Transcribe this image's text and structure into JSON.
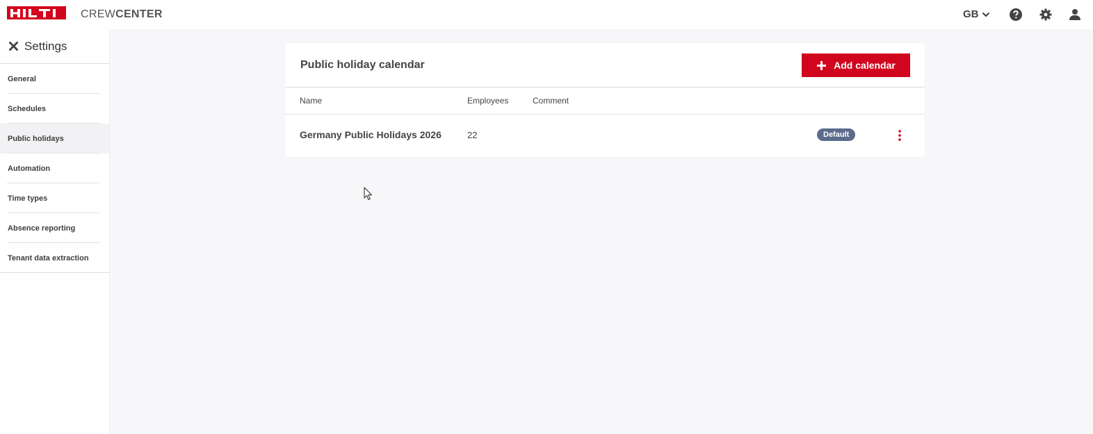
{
  "header": {
    "brand": "HILTI",
    "app_name_light": "CREW",
    "app_name_bold": "CENTER",
    "region": "GB",
    "icons": [
      "chevron-down-icon",
      "help-icon",
      "gear-icon",
      "user-icon"
    ],
    "brand_color": "#d2051e"
  },
  "sidebar": {
    "title": "Settings",
    "items": [
      {
        "label": "General",
        "active": false
      },
      {
        "label": "Schedules",
        "active": false
      },
      {
        "label": "Public holidays",
        "active": true
      },
      {
        "label": "Automation",
        "active": false
      },
      {
        "label": "Time types",
        "active": false
      },
      {
        "label": "Absence reporting",
        "active": false
      },
      {
        "label": "Tenant data extraction",
        "active": false
      }
    ]
  },
  "main": {
    "title": "Public holiday calendar",
    "add_button_label": "Add calendar",
    "columns": {
      "name": "Name",
      "employees": "Employees",
      "comment": "Comment"
    },
    "rows": [
      {
        "name": "Germany Public Holidays 2026",
        "employees": "22",
        "comment": "",
        "badge": "Default"
      }
    ]
  },
  "colors": {
    "accent": "#d2051e",
    "badge": "#5b6b8c"
  }
}
